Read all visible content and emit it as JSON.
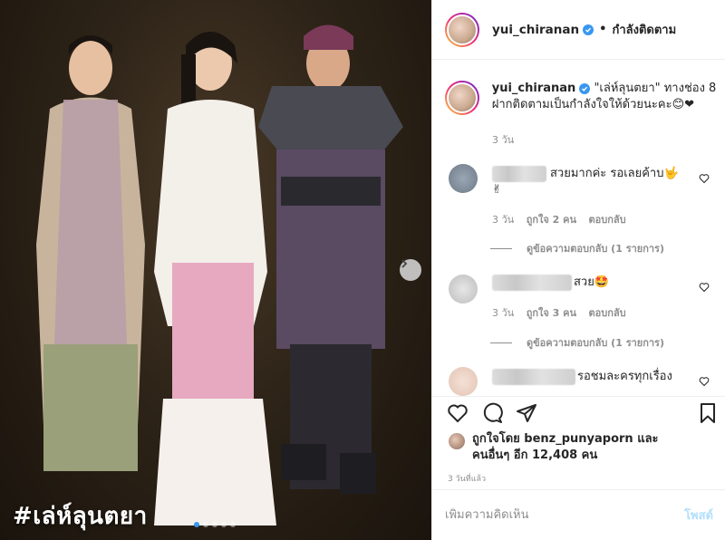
{
  "photo": {
    "caption": "#เล่ห์ลุนตยา",
    "carousel_dots": 5,
    "active_dot": 0
  },
  "header": {
    "username": "yui_chiranan",
    "separator": "•",
    "follow_label": "กำลังติดตาม"
  },
  "caption": {
    "username": "yui_chiranan",
    "text": " \"เล่ห์ลุนตยา\" ทางช่อง 8 ฝากติดตามเป็นกำลังใจให้ด้วยนะคะ😊❤",
    "time": "3 วัน"
  },
  "comments": [
    {
      "text": "สวยมากค่ะ รอเลยค้าบ🤟",
      "text2": "✌",
      "time": "3 วัน",
      "likes": "ถูกใจ 2 คน",
      "reply": "ตอบกลับ",
      "view_replies": "ดูข้อความตอบกลับ (1 รายการ)"
    },
    {
      "text": "สวย🤩",
      "time": "3 วัน",
      "likes": "ถูกใจ 3 คน",
      "reply": "ตอบกลับ",
      "view_replies": "ดูข้อความตอบกลับ (1 รายการ)"
    },
    {
      "text": "รอชมละครทุกเรื่อง"
    }
  ],
  "likes": {
    "line1": "ถูกใจโดย benz_punyaporn และ",
    "line2": "คนอื่นๆ อีก 12,408 คน"
  },
  "time_ago": "3 วันที่แล้ว",
  "add_comment": {
    "placeholder": "เพิ่มความคิดเห็น",
    "post_label": "โพสต์"
  },
  "colors": {
    "verified": "#3897f0",
    "post_disabled": "#b2dffc",
    "secondary_text": "#8e8e8e"
  }
}
